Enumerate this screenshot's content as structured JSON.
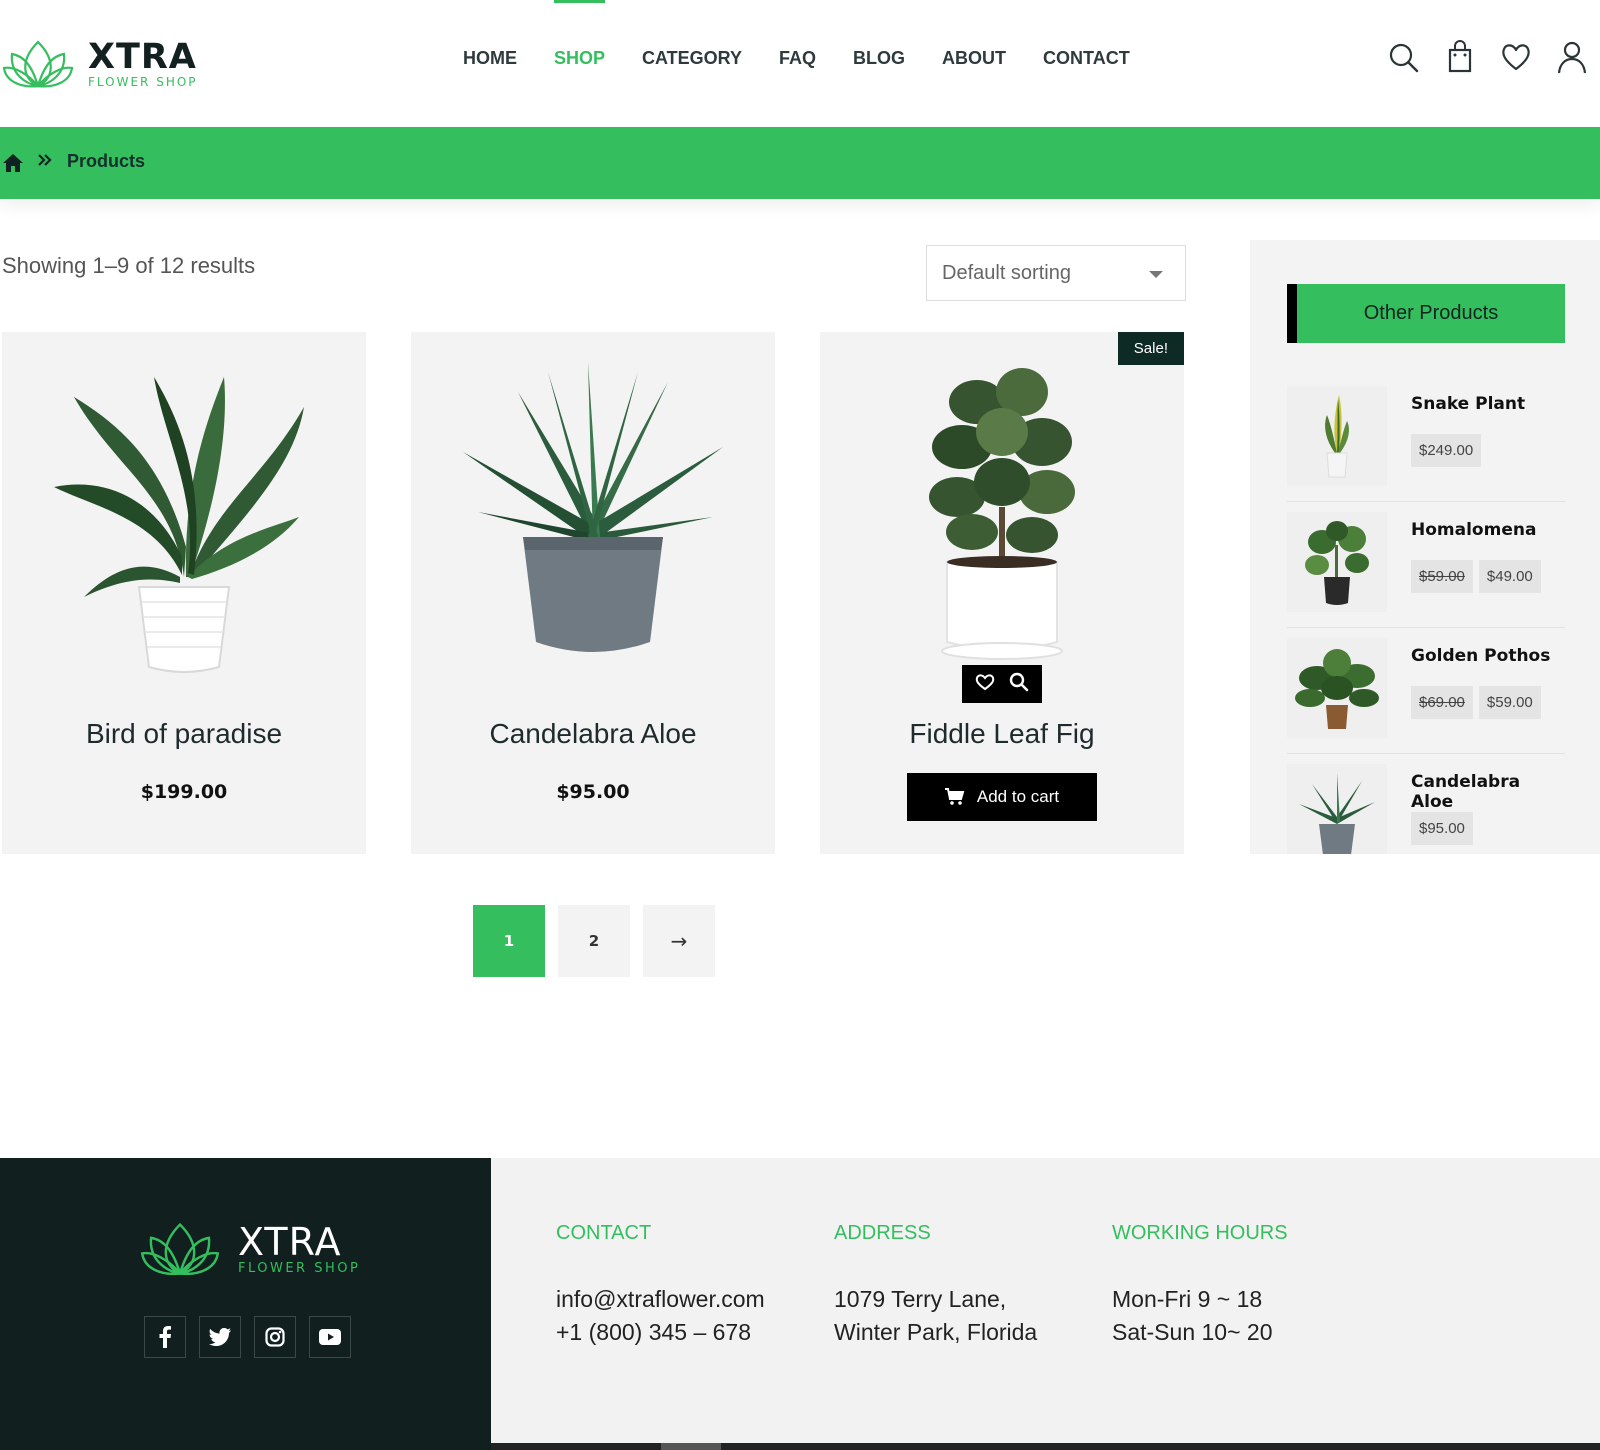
{
  "header": {
    "brand": "XTRA",
    "brand_sub": "FLOWER SHOP",
    "nav": [
      "HOME",
      "SHOP",
      "CATEGORY",
      "FAQ",
      "BLOG",
      "ABOUT",
      "CONTACT"
    ],
    "active_nav": "SHOP"
  },
  "breadcrumb": {
    "current": "Products"
  },
  "catalog": {
    "results_text": "Showing 1–9 of 12 results",
    "sort_value": "Default sorting"
  },
  "products": [
    {
      "name": "Bird of paradise",
      "price": "$199.00"
    },
    {
      "name": "Candelabra Aloe",
      "price": "$95.00"
    },
    {
      "name": "Fiddle Leaf Fig",
      "sale_badge": "Sale!",
      "add_to_cart": "Add to cart"
    }
  ],
  "sidebar": {
    "title": "Other Products",
    "items": [
      {
        "name": "Snake Plant",
        "price": "$249.00"
      },
      {
        "name": "Homalomena",
        "old_price": "$59.00",
        "price": "$49.00"
      },
      {
        "name": "Golden Pothos",
        "old_price": "$69.00",
        "price": "$59.00"
      },
      {
        "name": "Candelabra Aloe",
        "price": "$95.00"
      }
    ]
  },
  "pagination": {
    "pages": [
      "1",
      "2"
    ],
    "next": "→",
    "current": "1"
  },
  "footer": {
    "brand": "XTRA",
    "brand_sub": "FLOWER SHOP",
    "social": [
      "facebook-icon",
      "twitter-icon",
      "instagram-icon",
      "youtube-icon"
    ],
    "contact": {
      "heading": "CONTACT",
      "email": "info@xtraflower.com",
      "phone": "+1 (800) 345 – 678"
    },
    "address": {
      "heading": "ADDRESS",
      "line1": "1079 Terry Lane,",
      "line2": "Winter Park, Florida"
    },
    "hours": {
      "heading": "WORKING HOURS",
      "line1": "Mon-Fri 9 ~ 18",
      "line2": "Sat-Sun 10~ 20"
    }
  },
  "colors": {
    "accent": "#34be5e",
    "dark": "#111f1f",
    "card_bg": "#f3f3f3"
  }
}
